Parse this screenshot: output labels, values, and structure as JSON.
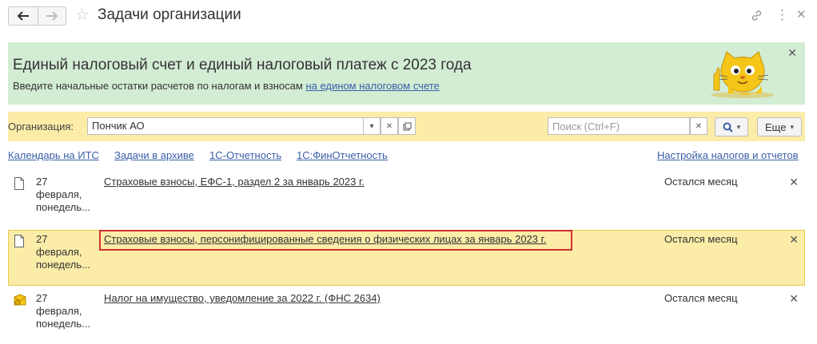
{
  "header": {
    "title": "Задачи организации",
    "back_icon": "arrow-left-icon",
    "forward_icon": "arrow-right-icon",
    "favorite_icon": "star-icon",
    "link_icon": "link-icon",
    "menu_icon": "more-vertical-icon",
    "close_icon": "close-icon"
  },
  "banner": {
    "title": "Единый налоговый счет и единый налоговый платеж с 2023 года",
    "subtitle_prefix": "Введите начальные остатки расчетов по налогам и взносам",
    "subtitle_link": "на едином налоговом счете",
    "background": "#d3ecd4"
  },
  "filter": {
    "org_label": "Организация:",
    "org_value": "Пончик АО",
    "search_placeholder": "Поиск (Ctrl+F)",
    "more_label": "Еще",
    "background": "#fbeca8"
  },
  "links": {
    "calendar": "Календарь на ИТС",
    "archive": "Задачи в архиве",
    "reporting": "1С-Отчетность",
    "fin_reporting": "1С:ФинОтчетность",
    "settings": "Настройка налогов и отчетов",
    "color": "#3b5ea8"
  },
  "tasks": [
    {
      "icon": "document-icon",
      "date_day": "27",
      "date_month": "февраля,",
      "date_weekday": "понедель...",
      "title": "Страховые взносы, ЕФС-1, раздел 2 за январь 2023 г.",
      "status": "Остался месяц"
    },
    {
      "icon": "document-icon",
      "date_day": "27",
      "date_month": "февраля,",
      "date_weekday": "понедель...",
      "title": "Страховые взносы, персонифицированные сведения о физических лицах за январь 2023 г.",
      "status": "Остался месяц",
      "selected": true,
      "highlight_color": "#d32f2f"
    },
    {
      "icon": "envelope-icon",
      "date_day": "27",
      "date_month": "февраля,",
      "date_weekday": "понедель...",
      "title": "Налог на имущество, уведомление за 2022 г. (ФНС 2634)",
      "status": "Остался месяц"
    }
  ]
}
